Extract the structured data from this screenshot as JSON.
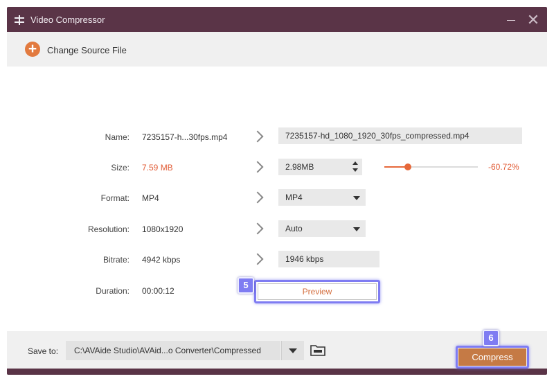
{
  "window": {
    "title": "Video Compressor",
    "app_icon": "compress-icon",
    "minimize_icon": "minimize-icon",
    "close_icon": "close-icon",
    "close_glyph": "✕"
  },
  "toolbar": {
    "change_source_label": "Change Source File",
    "add_icon": "plus-icon",
    "add_glyph": "+"
  },
  "labels": {
    "name": "Name:",
    "size": "Size:",
    "format": "Format:",
    "resolution": "Resolution:",
    "bitrate": "Bitrate:",
    "duration": "Duration:"
  },
  "source": {
    "name": "7235157-h...30fps.mp4",
    "size": "7.59 MB",
    "format": "MP4",
    "resolution": "1080x1920",
    "bitrate": "4942 kbps",
    "duration": "00:00:12"
  },
  "output": {
    "name": "7235157-hd_1080_1920_30fps_compressed.mp4",
    "size": "2.98MB",
    "format": "MP4",
    "resolution": "Auto",
    "bitrate": "1946 kbps"
  },
  "size_slider": {
    "value_fraction": 0.25,
    "percent_label": "-60.72%"
  },
  "preview_label": "Preview",
  "annotations": {
    "preview_badge": "5",
    "compress_badge": "6",
    "highlight_color": "#7f7cf2"
  },
  "footer": {
    "save_to_label": "Save to:",
    "save_path": "C:\\AVAide Studio\\AVAid...o Converter\\Compressed",
    "folder_icon": "folder-icon",
    "compress_label": "Compress"
  },
  "colors": {
    "titlebar": "#5a3447",
    "accent": "#e6683a",
    "compress_button": "#c57a45",
    "warn_text": "#e15b35"
  }
}
